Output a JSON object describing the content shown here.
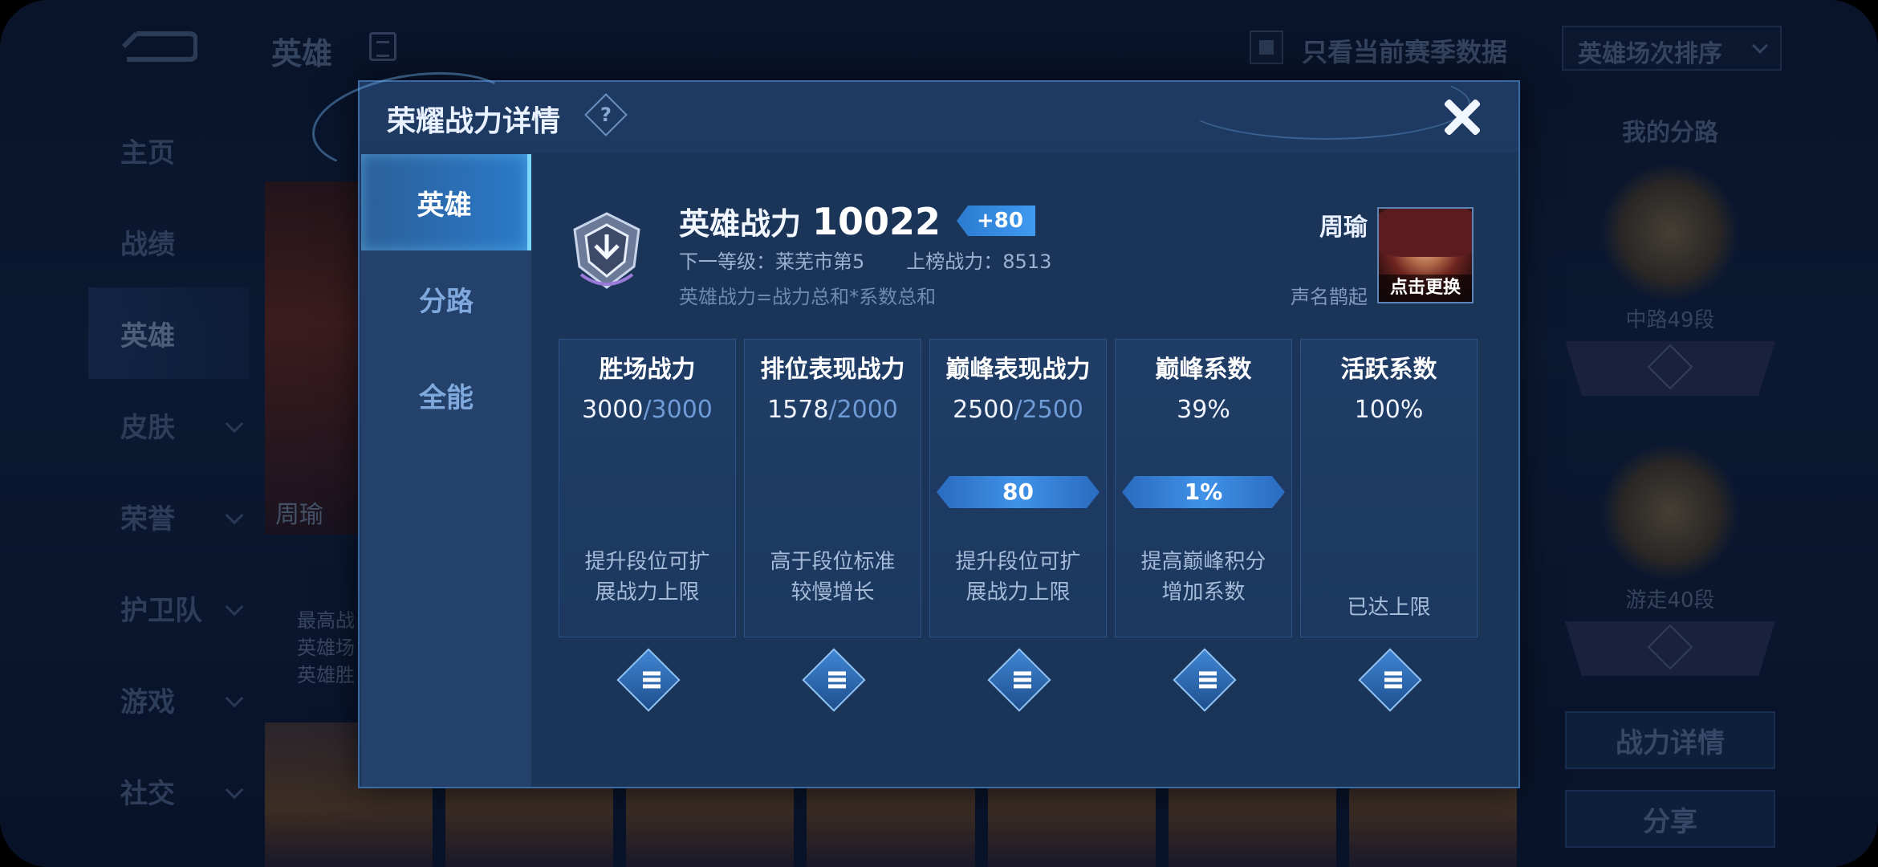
{
  "background": {
    "page_title": "英雄",
    "sidebar": [
      "主页",
      "战绩",
      "英雄",
      "皮肤",
      "荣誉",
      "护卫队",
      "游戏",
      "社交"
    ],
    "active_sidebar": "英雄",
    "checkbox_label": "只看当前赛季数据",
    "sort_label": "英雄场次排序",
    "hero_card_name": "周瑜",
    "hero_stats": [
      "最高战",
      "英雄场",
      "英雄胜"
    ],
    "right_panel": {
      "title": "我的分路",
      "badge1": "中路49段",
      "badge2": "游走40段",
      "power_detail_btn": "战力详情",
      "share_btn": "分享"
    }
  },
  "modal": {
    "title": "荣耀战力详情",
    "help_glyph": "?",
    "tabs": [
      "英雄",
      "分路",
      "全能"
    ],
    "active_tab": "英雄",
    "power_label": "英雄战力",
    "power_value": "10022",
    "power_delta": "+80",
    "next_level": "下一等级：莱芜市第5",
    "list_power": "上榜战力：8513",
    "formula": "英雄战力=战力总和*系数总和",
    "hero_name": "周瑜",
    "hero_fame": "声名鹊起",
    "change_label": "点击更换",
    "cards": [
      {
        "title": "胜场战力",
        "current": "3000",
        "max": "/3000",
        "tag": "",
        "desc": "提升段位可扩\n展战力上限"
      },
      {
        "title": "排位表现战力",
        "current": "1578",
        "max": "/2000",
        "tag": "",
        "desc": "高于段位标准\n较慢增长"
      },
      {
        "title": "巅峰表现战力",
        "current": "2500",
        "max": "/2500",
        "tag": "80",
        "desc": "提升段位可扩\n展战力上限"
      },
      {
        "title": "巅峰系数",
        "current": "39%",
        "max": "",
        "tag": "1%",
        "desc": "提高巅峰积分\n增加系数"
      },
      {
        "title": "活跃系数",
        "current": "100%",
        "max": "",
        "tag": "",
        "desc": "已达上限"
      }
    ]
  },
  "colors": {
    "accent": "#3f92e8",
    "modal_bg": "#1c365c",
    "tab_active": "#2a7ac8"
  }
}
